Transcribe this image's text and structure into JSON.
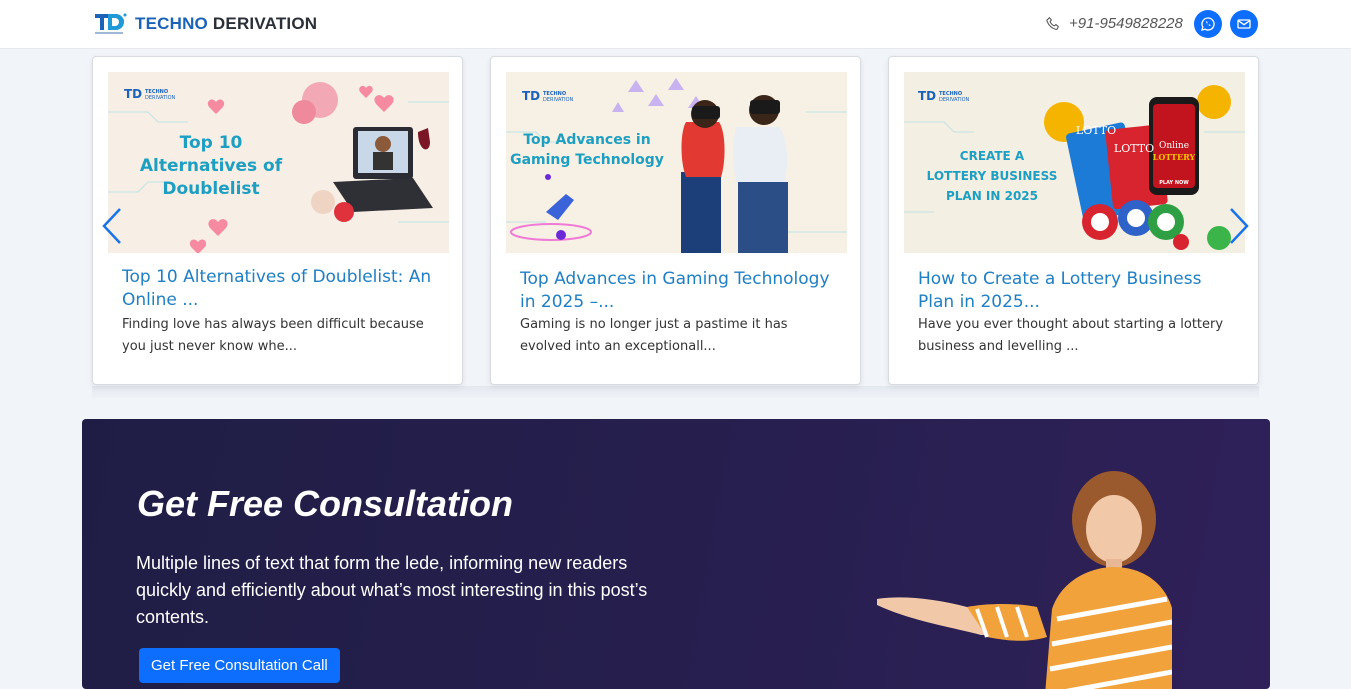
{
  "header": {
    "brand_a": "TECHNO",
    "brand_b": "DERIVATION",
    "phone": "+91-9549828228"
  },
  "cards": [
    {
      "title": "Top 10 Alternatives of Doublelist: An Online ...",
      "excerpt": "Finding love has always been difficult because you just never know whe...",
      "image_text": [
        "Top 10",
        "Alternatives of",
        "Doublelist"
      ]
    },
    {
      "title": "Top Advances in Gaming Technology in 2025 –...",
      "excerpt": "Gaming is no longer just a pastime it has evolved into an exceptionall...",
      "image_text": [
        "Top Advances in",
        "Gaming Technology"
      ]
    },
    {
      "title": "How to Create a Lottery Business Plan in 2025...",
      "excerpt": "Have you ever thought about starting a lottery business and levelling ...",
      "image_text": [
        "CREATE A",
        "LOTTERY BUSINESS",
        "PLAN IN 2025"
      ]
    }
  ],
  "thumb_logo": {
    "line1": "TECHNO",
    "line2": "DERIVATION"
  },
  "lottery_text": {
    "ticket": "LOTTO",
    "phone_line1": "Online",
    "phone_line2": "LOTTERY",
    "play": "PLAY NOW"
  },
  "consultation": {
    "heading": "Get Free Consultation",
    "lede": "Multiple lines of text that form the lede, informing new readers quickly and efficiently about what’s most interesting in this post’s contents.",
    "cta": "Get Free Consultation Call"
  },
  "icons": {
    "phone": "phone-icon",
    "whatsapp": "whatsapp-icon",
    "mail": "mail-icon",
    "prev": "chevron-left-icon",
    "next": "chevron-right-icon"
  },
  "colors": {
    "accent": "#0d6efd",
    "brand_blue": "#1a63b8",
    "card_title": "#1e7fc4",
    "banner_bg": "#241f4c"
  }
}
